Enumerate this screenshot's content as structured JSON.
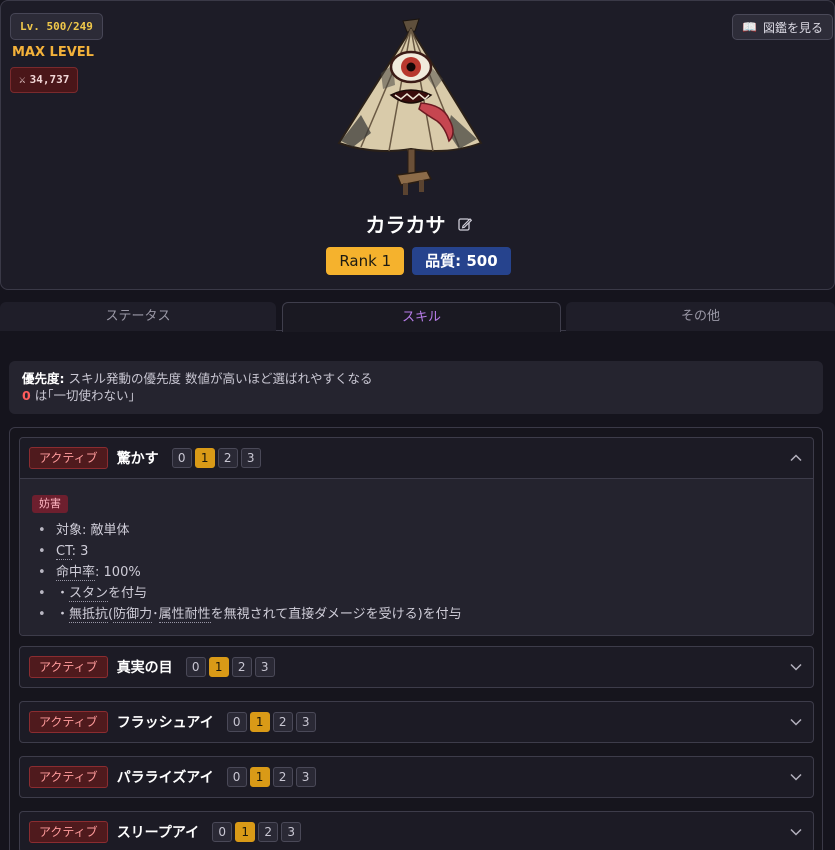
{
  "header": {
    "level": "Lv. 500/249",
    "max_level": "MAX LEVEL",
    "power": "34,737",
    "encyclopedia_button": "図鑑を見る",
    "name": "カラカサ",
    "rank": "Rank 1",
    "quality": "品質: 500"
  },
  "tabs": [
    {
      "label": "ステータス",
      "active": false
    },
    {
      "label": "スキル",
      "active": true
    },
    {
      "label": "その他",
      "active": false
    }
  ],
  "info": {
    "label": "優先度:",
    "text": "スキル発動の優先度 数値が高いほど選ばれやすくなる",
    "zero": "0",
    "zero_text": "は｢一切使わない｣"
  },
  "skills": [
    {
      "type": "アクティブ",
      "name": "驚かす",
      "priorities": [
        "0",
        "1",
        "2",
        "3"
      ],
      "selected": 1,
      "expanded": true,
      "tag": "妨害",
      "effects": {
        "target_label": "対象",
        "target_value": "敵単体",
        "ct_label": "CT",
        "ct_value": "3",
        "hit_label": "命中率",
        "hit_value": "100%",
        "stun_prefix": "・",
        "stun_name": "スタン",
        "stun_suffix": "を付与",
        "noresist_prefix": "・",
        "noresist_name": "無抵抗",
        "noresist_open": "(",
        "defense": "防御力",
        "middot": "･",
        "attr_resist": "属性耐性",
        "noresist_suffix": "を無視されて直接ダメージを受ける)を付与"
      }
    },
    {
      "type": "アクティブ",
      "name": "真実の目",
      "priorities": [
        "0",
        "1",
        "2",
        "3"
      ],
      "selected": 1,
      "expanded": false
    },
    {
      "type": "アクティブ",
      "name": "フラッシュアイ",
      "priorities": [
        "0",
        "1",
        "2",
        "3"
      ],
      "selected": 1,
      "expanded": false
    },
    {
      "type": "アクティブ",
      "name": "パラライズアイ",
      "priorities": [
        "0",
        "1",
        "2",
        "3"
      ],
      "selected": 1,
      "expanded": false
    },
    {
      "type": "アクティブ",
      "name": "スリープアイ",
      "priorities": [
        "0",
        "1",
        "2",
        "3"
      ],
      "selected": 1,
      "expanded": false
    }
  ],
  "colors": {
    "accent_gold": "#f5b22d",
    "quality_blue": "#26438d",
    "active_tab": "#b67ce8",
    "active_badge": "#ff9b9b"
  }
}
